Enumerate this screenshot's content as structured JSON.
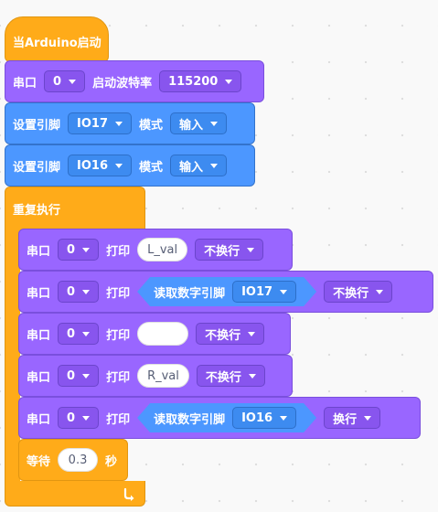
{
  "hat": {
    "label": "当Arduino启动"
  },
  "serial_begin": {
    "label": "串口",
    "port": "0",
    "baud_label": "启动波特率",
    "baud": "115200"
  },
  "pin_modes": [
    {
      "label": "设置引脚",
      "pin": "IO17",
      "mode_label": "模式",
      "mode": "输入"
    },
    {
      "label": "设置引脚",
      "pin": "IO16",
      "mode_label": "模式",
      "mode": "输入"
    }
  ],
  "repeat": {
    "label": "重复执行"
  },
  "prints": [
    {
      "serial": "串口",
      "port": "0",
      "print": "打印",
      "value": "L_val",
      "newline": "不换行"
    },
    {
      "serial": "串口",
      "port": "0",
      "print": "打印",
      "reporter": "读取数字引脚",
      "pin": "IO17",
      "newline": "不换行"
    },
    {
      "serial": "串口",
      "port": "0",
      "print": "打印",
      "value": "",
      "newline": "不换行"
    },
    {
      "serial": "串口",
      "port": "0",
      "print": "打印",
      "value": "R_val",
      "newline": "不换行"
    },
    {
      "serial": "串口",
      "port": "0",
      "print": "打印",
      "reporter": "读取数字引脚",
      "pin": "IO16",
      "newline": "换行"
    }
  ],
  "wait": {
    "label": "等待",
    "value": "0.3",
    "unit": "秒"
  },
  "icons": {
    "loop": "loop-arrow-icon",
    "dropdown": "caret-down-icon"
  },
  "colors": {
    "events": "#ffab19",
    "serial": "#9966ff",
    "pins": "#4c97ff",
    "background": "#f9f9f9"
  }
}
